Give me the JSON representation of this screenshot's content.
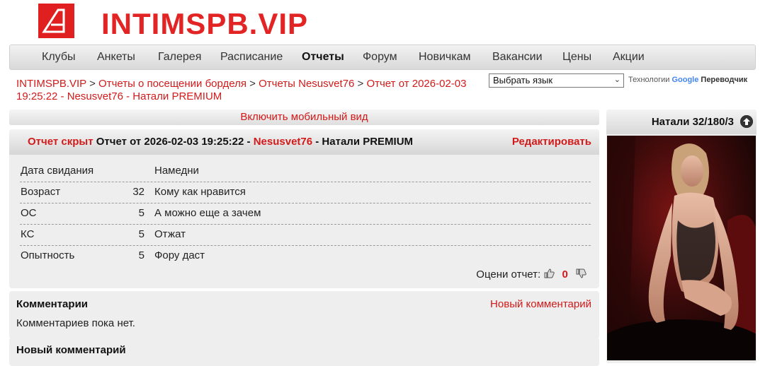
{
  "site": {
    "title": "INTIMSPB.VIP"
  },
  "nav": {
    "items": [
      "Клубы",
      "Анкеты",
      "Галерея",
      "Расписание",
      "Отчеты",
      "Форум",
      "Новичкам",
      "Вакансии",
      "Цены",
      "Акции"
    ],
    "active": "Отчеты"
  },
  "breadcrumb": {
    "home": "INTIMSPB.VIP",
    "sep": ">",
    "section": "Отчеты о посещении борделя",
    "author_reports": "Отчеты Nesusvet76",
    "current": "Отчет от 2026-02-03 19:25:22 - Nesusvet76 - Натали PREMIUM"
  },
  "translate": {
    "select_value": "Выбрать язык",
    "tech_label": "Технологии",
    "google": "Google",
    "translator": "Переводчик"
  },
  "mobile": {
    "label": "Включить мобильный вид"
  },
  "report": {
    "hidden_label": "Отчет скрыт",
    "title_prefix": "Отчет от 2026-02-03 19:25:22 -",
    "author": "Nesusvet76",
    "title_suffix": "- Натали PREMIUM",
    "edit_label": "Редактировать",
    "rows": [
      {
        "label": "Дата свидания",
        "num": "",
        "value": "Намедни"
      },
      {
        "label": "Возраст",
        "num": "32",
        "value": "Кому как нравится"
      },
      {
        "label": "ОС",
        "num": "5",
        "value": "А можно еще а зачем"
      },
      {
        "label": "КС",
        "num": "5",
        "value": "Отжат"
      },
      {
        "label": "Опытность",
        "num": "5",
        "value": "Фору даст"
      }
    ],
    "rate_label": "Оцени отчет:",
    "rate_count": "0"
  },
  "comments": {
    "title": "Комментарии",
    "new_link": "Новый комментарий",
    "empty_text": "Комментариев пока нет."
  },
  "new_comment": {
    "title": "Новый комментарий"
  },
  "profile": {
    "header": "Натали 32/180/3"
  },
  "colors": {
    "brand_red": "#e22424",
    "link_red": "#d21a1a"
  },
  "icons": {
    "logo": "logo-icon",
    "chevron": "chevron-down-icon",
    "thumb_up": "thumb-up-icon",
    "thumb_down": "thumb-down-icon",
    "up_arrow": "arrow-up-circle-icon"
  }
}
